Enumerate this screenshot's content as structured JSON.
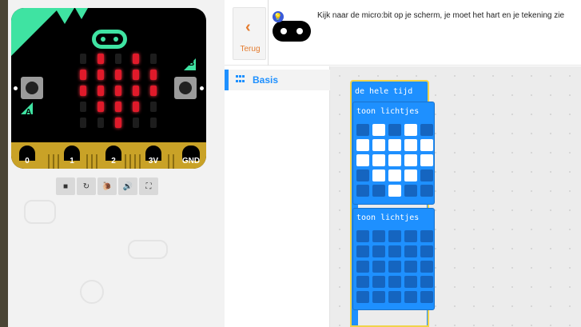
{
  "simulator": {
    "board": {
      "leds": [
        [
          0,
          1,
          0,
          1,
          0
        ],
        [
          1,
          1,
          1,
          1,
          1
        ],
        [
          1,
          1,
          1,
          1,
          1
        ],
        [
          0,
          1,
          1,
          1,
          0
        ],
        [
          0,
          0,
          1,
          0,
          0
        ]
      ],
      "button_a_label": "A",
      "button_b_label": "B",
      "pins": [
        "0",
        "1",
        "2",
        "3V",
        "GND"
      ],
      "colors": {
        "accent": "#3fe3a2",
        "led_on": "#e01a2a",
        "edge": "#c9a227"
      }
    },
    "toolbar": {
      "icons": [
        "stop-icon",
        "restart-icon",
        "slow-mo-icon",
        "sound-icon",
        "fullscreen-icon"
      ],
      "glyphs": [
        "■",
        "↻",
        "🐌",
        "🔊",
        "⛶"
      ]
    }
  },
  "tutorial": {
    "back_label": "Terug",
    "text": "Kijk naar de micro:bit op je scherm, je moet het hart en je tekening zie"
  },
  "toolbox": {
    "category": "Basis",
    "color": "#1e90ff"
  },
  "blocks": {
    "forever_label": "de hele tijd",
    "show_leds_1": {
      "label": "toon lichtjes",
      "grid": [
        [
          0,
          1,
          0,
          1,
          0
        ],
        [
          1,
          1,
          1,
          1,
          1
        ],
        [
          1,
          1,
          1,
          1,
          1
        ],
        [
          0,
          1,
          1,
          1,
          0
        ],
        [
          0,
          0,
          1,
          0,
          0
        ]
      ]
    },
    "show_leds_2": {
      "label": "toon lichtjes",
      "grid": [
        [
          0,
          0,
          0,
          0,
          0
        ],
        [
          0,
          0,
          0,
          0,
          0
        ],
        [
          0,
          0,
          0,
          0,
          0
        ],
        [
          0,
          0,
          0,
          0,
          0
        ],
        [
          0,
          0,
          0,
          0,
          0
        ]
      ]
    }
  }
}
